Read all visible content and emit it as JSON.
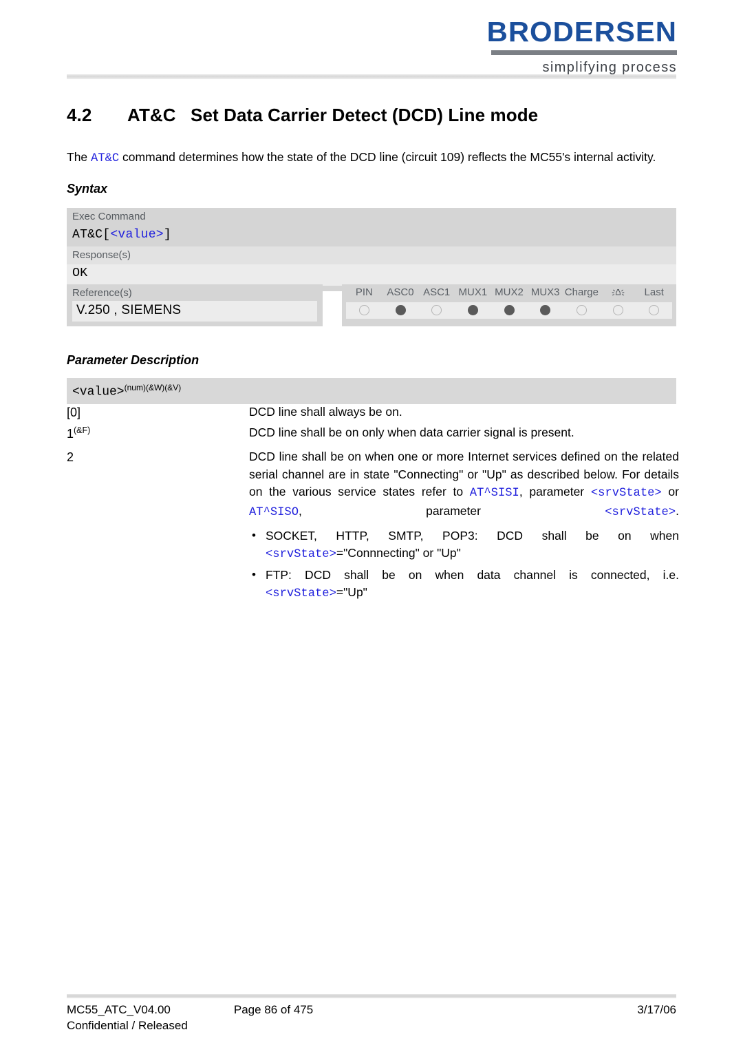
{
  "brand": {
    "name": "BRODERSEN",
    "tagline": "simplifying process",
    "color": "#1b4f9c"
  },
  "section": {
    "number": "4.2",
    "command": "AT&C",
    "title": "Set Data Carrier Detect (DCD) Line mode"
  },
  "intro": {
    "part1": "The ",
    "code": "AT&C",
    "part2": " command determines how the state of the DCD line (circuit 109) reflects the MC55's internal activity."
  },
  "headings": {
    "syntax": "Syntax",
    "parameter_description": "Parameter Description"
  },
  "syntax_table": {
    "exec_label": "Exec Command",
    "exec_command_prefix": "AT&C",
    "exec_command_bracket_open": "[",
    "exec_command_param": "<value>",
    "exec_command_bracket_close": "]",
    "response_label": "Response(s)",
    "response_value": "OK"
  },
  "references": {
    "label": "Reference(s)",
    "value": "V.250 , SIEMENS"
  },
  "pin_table": {
    "columns": [
      "PIN",
      "ASC0",
      "ASC1",
      "MUX1",
      "MUX2",
      "MUX3",
      "Charge",
      "alarm-icon",
      "Last"
    ],
    "alarm_column_index": 7,
    "states": [
      "off",
      "on",
      "off",
      "on",
      "on",
      "on",
      "off",
      "off",
      "off"
    ]
  },
  "parameter": {
    "name": "<value>",
    "superscript": "(num)(&W)(&V)",
    "rows": [
      {
        "key": "[0]",
        "key_sup": "",
        "text": "DCD line shall always be on."
      },
      {
        "key": "1",
        "key_sup": "(&F)",
        "text": "DCD line shall be on only when data carrier signal is present."
      },
      {
        "key": "2",
        "key_sup": "",
        "text_line1": "DCD line shall be on when one or more Internet services defined on the related serial channel are in state \"Connecting\" or \"Up\" as described below. For details on the various service states refer to ",
        "code1": "AT^SISI",
        "text_mid1": ", parameter ",
        "code2": "<srvState>",
        "text_mid2": " or ",
        "code3": "AT^SISO",
        "text_mid3": ", parameter ",
        "code4": "<srvState>",
        "text_end": "."
      }
    ],
    "bullets": [
      {
        "marker": "•",
        "line1": "SOCKET, HTTP, SMTP, POP3: DCD shall be on when",
        "code": "<srvState>",
        "line2": "=\"Connnecting\" or \"Up\""
      },
      {
        "marker": "•",
        "line1": "FTP: DCD shall be on when data channel is connected, i.e.",
        "code": "<srvState>",
        "line2": "=\"Up\""
      }
    ]
  },
  "footer": {
    "document_id": "MC55_ATC_V04.00",
    "page": "Page 86 of 475",
    "date": "3/17/06",
    "classification": "Confidential / Released"
  },
  "colors": {
    "code_blue": "#2222dd",
    "brand_blue": "#1b4f9c",
    "band_gray": "#d5d5d5",
    "light_gray": "#ececec"
  }
}
